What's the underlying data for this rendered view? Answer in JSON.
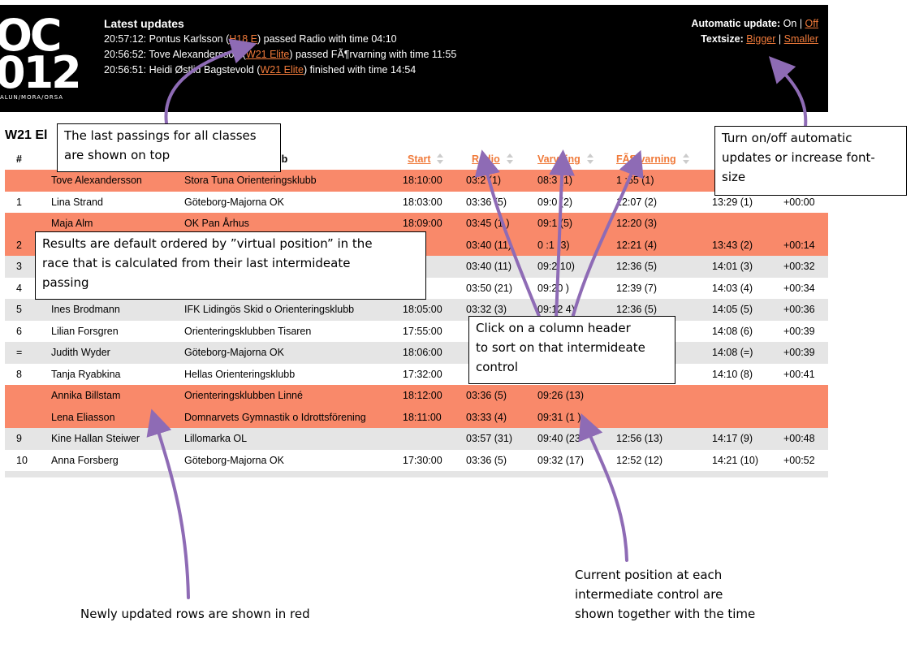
{
  "header": {
    "updates_title": "Latest updates",
    "updates": [
      {
        "prefix": "20:57:12: Pontus Karlsson (",
        "link": "H18 E",
        "suffix": ") passed Radio with time 04:10"
      },
      {
        "prefix": "20:56:52: Tove Alexandersson (",
        "link": "W21 Elite",
        "suffix": ") passed FÃ¶rvarning with time 11:55"
      },
      {
        "prefix": "20:56:51: Heidi Østlid Bagstevold (",
        "link": "W21 Elite",
        "suffix": ") finished with time 14:54"
      }
    ],
    "auto_label": "Automatic update:",
    "auto_on": "On",
    "auto_sep": "|",
    "auto_off": "Off",
    "text_label": "Textsize:",
    "text_bigger": "Bigger",
    "text_sep": "|",
    "text_smaller": "Smaller",
    "logo_line1": "OC",
    "logo_line2": "012",
    "logo_line3": "ALUN/MORA/ORSA"
  },
  "results": {
    "class_title": "W21 El",
    "columns": {
      "pos": "#",
      "club": "ub",
      "start": "Start",
      "radio": "Radio",
      "varvning": "Varvning",
      "forvarning": "FÃ¶rvarning"
    },
    "rows": [
      {
        "style": "red",
        "pos": "",
        "name": "Tove Alexandersson",
        "club": "Stora Tuna Orienteringsklubb",
        "start": "18:10:00",
        "radio": "03:2 (1)",
        "varvning": "08:3 (1)",
        "forvarning": "1 :55 (1)",
        "finish": "",
        "diff": ""
      },
      {
        "style": "white",
        "pos": "1",
        "name": "Lina Strand",
        "club": "Göteborg-Majorna OK",
        "start": "18:03:00",
        "radio": "03:36 (5)",
        "varvning": "09:0 (2)",
        "forvarning": "12:07 (2)",
        "finish": "13:29 (1)",
        "diff": "+00:00"
      },
      {
        "style": "red",
        "pos": "",
        "name": "Maja Alm",
        "club": "OK Pan Århus",
        "start": "18:09:00",
        "radio": "03:45 (1 )",
        "varvning": "09:1 (5)",
        "forvarning": "12:20 (3)",
        "finish": "",
        "diff": ""
      },
      {
        "style": "red",
        "pos": "2",
        "name": "",
        "club": "",
        "start": "8:00",
        "radio": "03:40 (11)",
        "varvning": "0 :1 (3)",
        "forvarning": "12:21 (4)",
        "finish": "13:43 (2)",
        "diff": "+00:14"
      },
      {
        "style": "gray",
        "pos": "3",
        "name": "",
        "club": "",
        "start": "4:00",
        "radio": "03:40 (11)",
        "varvning": "09:2 10)",
        "forvarning": "12:36 (5)",
        "finish": "14:01 (3)",
        "diff": "+00:32"
      },
      {
        "style": "white",
        "pos": "4",
        "name": "",
        "club": "",
        "start": "3:00",
        "radio": "03:50 (21)",
        "varvning": "09:20 )",
        "forvarning": "12:39 (7)",
        "finish": "14:03 (4)",
        "diff": "+00:34"
      },
      {
        "style": "gray",
        "pos": "5",
        "name": "Ines Brodmann",
        "club": "IFK Lidingös Skid o Orienteringsklubb",
        "start": "18:05:00",
        "radio": "03:32 (3)",
        "varvning": "09:12 4)",
        "forvarning": "12:36 (5)",
        "finish": "14:05 (5)",
        "diff": "+00:36"
      },
      {
        "style": "white",
        "pos": "6",
        "name": "Lilian Forsgren",
        "club": "Orienteringsklubben Tisaren",
        "start": "17:55:00",
        "radio": "",
        "varvning": "",
        "forvarning": "",
        "finish": "14:08 (6)",
        "diff": "+00:39"
      },
      {
        "style": "gray",
        "pos": "=",
        "name": "Judith Wyder",
        "club": "Göteborg-Majorna OK",
        "start": "18:06:00",
        "radio": "",
        "varvning": "",
        "forvarning": "",
        "finish": "14:08 (=)",
        "diff": "+00:39"
      },
      {
        "style": "white",
        "pos": "8",
        "name": "Tanja Ryabkina",
        "club": "Hellas Orienteringsklubb",
        "start": "17:32:00",
        "radio": "",
        "varvning": "",
        "forvarning": "",
        "finish": "14:10 (8)",
        "diff": "+00:41"
      },
      {
        "style": "red",
        "pos": "",
        "name": "Annika Billstam",
        "club": "Orienteringsklubben Linné",
        "start": "18:12:00",
        "radio": "03:36 (5)",
        "varvning": "09:26 (13)",
        "forvarning": "",
        "finish": "",
        "diff": ""
      },
      {
        "style": "red",
        "pos": "",
        "name": "Lena Eliasson",
        "club": "Domnarvets Gymnastik o Idrottsförening",
        "start": "18:11:00",
        "radio": "03:33 (4)",
        "varvning": "09:31 (1 )",
        "forvarning": "",
        "finish": "",
        "diff": ""
      },
      {
        "style": "gray",
        "pos": "9",
        "name": "Kine Hallan Steiwer",
        "club": "Lillomarka OL",
        "start": "",
        "radio": "03:57 (31)",
        "varvning": "09:40 (23",
        "forvarning": "12:56 (13)",
        "finish": "14:17 (9)",
        "diff": "+00:48"
      },
      {
        "style": "white",
        "pos": "10",
        "name": "Anna Forsberg",
        "club": "Göteborg-Majorna OK",
        "start": "17:30:00",
        "radio": "03:36 (5)",
        "varvning": "09:32 (17)",
        "forvarning": "12:52 (12)",
        "finish": "14:21 (10)",
        "diff": "+00:52"
      }
    ]
  },
  "annotations": {
    "passings": [
      "The last passings for all classes",
      "are shown on top"
    ],
    "autoupdate": [
      "Turn on/off automatic",
      "updates or increase font-",
      "size"
    ],
    "ordering": [
      "Results are default ordered by ”virtual position” in the",
      "race that is calculated from their last  intermideate",
      "passing"
    ],
    "sorting": [
      "Click on a column header",
      "to sort on that intermideate",
      "control"
    ],
    "newly": "Newly updated rows are shown in red",
    "position": [
      "Current position at each",
      "intermediate control are",
      "shown together with the time"
    ]
  },
  "colors": {
    "accent": "#f07a3a",
    "header_bg": "#000000",
    "new_row": "#f9896a",
    "alt_row": "#e5e5e5",
    "arrow": "#8e6bb5"
  }
}
